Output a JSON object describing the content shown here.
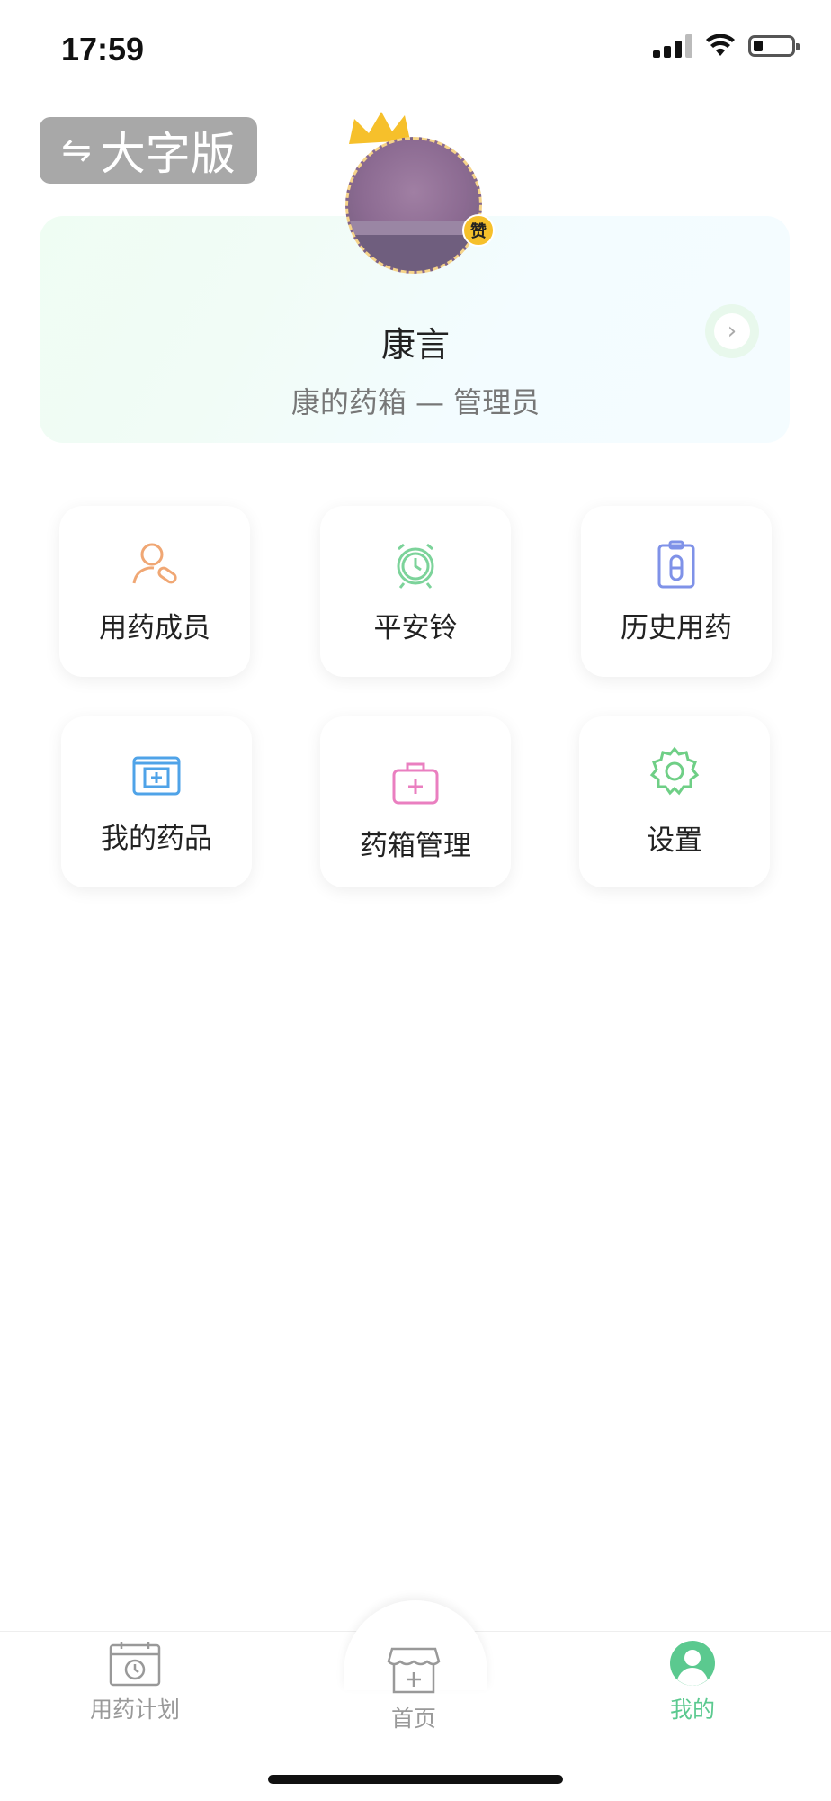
{
  "status_bar": {
    "time": "17:59"
  },
  "large_print": {
    "icon": "swap-icon",
    "label": "大字版"
  },
  "profile": {
    "name": "康言",
    "role": "康的药箱 — 管理员",
    "badge": "赞",
    "crown_color": "#f6c02b"
  },
  "menu": [
    {
      "label": "用药成员",
      "icon": "member-pill-icon",
      "color": "#f0a774"
    },
    {
      "label": "平安铃",
      "icon": "alarm-clock-icon",
      "color": "#7cd39a"
    },
    {
      "label": "历史用药",
      "icon": "history-clipboard-icon",
      "color": "#7f92e8"
    },
    {
      "label": "我的药品",
      "icon": "medicine-box-icon",
      "color": "#4fa3e8"
    },
    {
      "label": "药箱管理",
      "icon": "medical-bag-icon",
      "color": "#ea7fc0"
    },
    {
      "label": "设置",
      "icon": "gear-icon",
      "color": "#6fcf86"
    }
  ],
  "tabbar": {
    "plan": "用药计划",
    "home": "首页",
    "mine": "我的",
    "active_color": "#5bc98f",
    "inactive_color": "#999999"
  }
}
